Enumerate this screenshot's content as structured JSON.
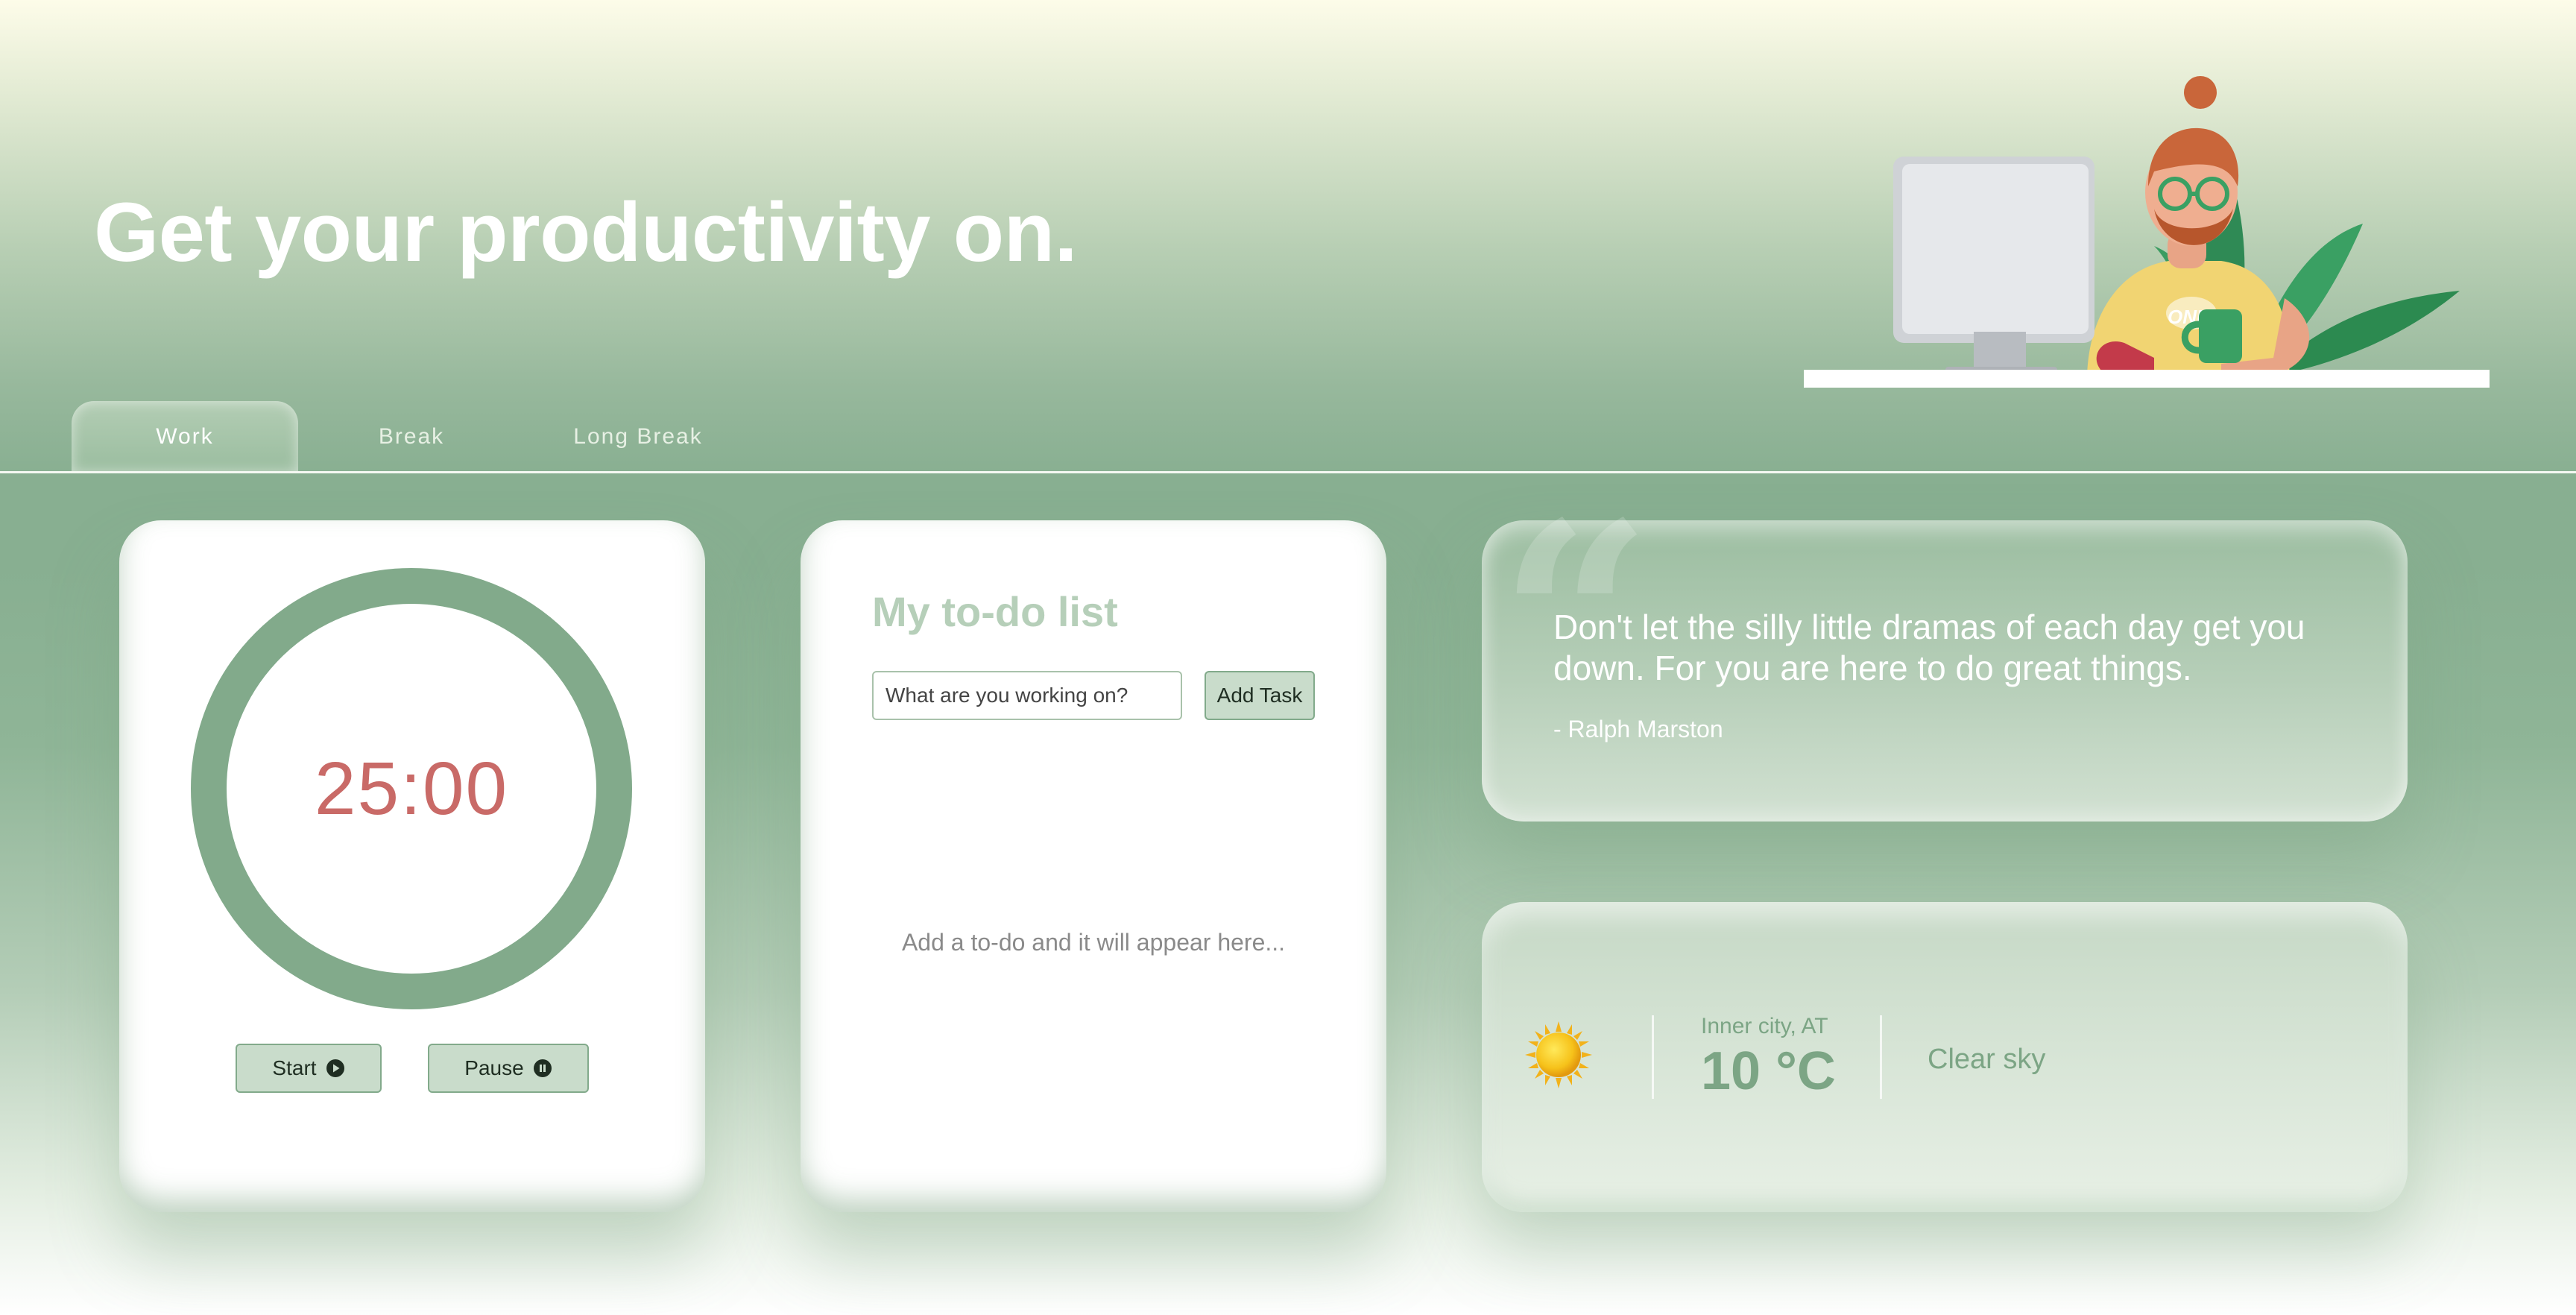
{
  "header": {
    "headline": "Get your productivity on."
  },
  "tabs": [
    {
      "label": "Work",
      "active": true
    },
    {
      "label": "Break",
      "active": false
    },
    {
      "label": "Long Break",
      "active": false
    }
  ],
  "timer": {
    "display": "25:00",
    "start_label": "Start",
    "start_icon": "play-circle-icon",
    "pause_label": "Pause",
    "pause_icon": "pause-circle-icon",
    "ring_color": "#82aa8b",
    "digits_color": "#c96a67"
  },
  "todo": {
    "title": "My to-do list",
    "input_placeholder": "What are you working on?",
    "input_value": "",
    "add_label": "Add Task",
    "empty_message": "Add a to-do and it will appear here..."
  },
  "quote": {
    "text": "Don't let the silly little dramas of each day get you down. For you are here to do great things.",
    "author": "- Ralph Marston"
  },
  "weather": {
    "icon": "sun-icon",
    "location": "Inner city, AT",
    "temperature": "10 °C",
    "condition": "Clear sky"
  },
  "colors": {
    "accent_green": "#82aa8b",
    "timer_red": "#c96a67",
    "muted_title": "#b6cfb9"
  }
}
